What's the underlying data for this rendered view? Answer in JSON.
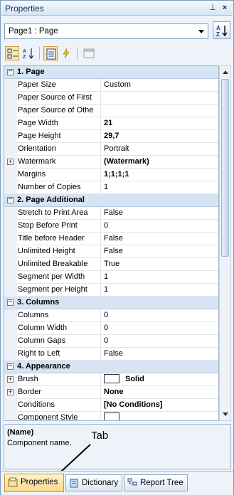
{
  "window": {
    "title": "Properties",
    "pin_glyph": "⊥",
    "close_glyph": "×"
  },
  "selector": {
    "value": "Page1 : Page"
  },
  "toolbar": {
    "buttons": [
      {
        "name": "categorized-icon",
        "active": true
      },
      {
        "name": "alphabetical-icon",
        "active": false
      },
      {
        "name": "properties-view-icon",
        "active": true
      },
      {
        "name": "events-lightning-icon",
        "active": false
      },
      {
        "name": "property-pages-icon",
        "active": false
      }
    ]
  },
  "grid": {
    "sections": [
      {
        "title": "1. Page",
        "expander": "−",
        "rows": [
          {
            "name": "Paper Size",
            "value": "Custom"
          },
          {
            "name": "Paper Source of First",
            "value": ""
          },
          {
            "name": "Paper Source of Othe",
            "value": ""
          },
          {
            "name": "Page Width",
            "value": "21",
            "bold": true
          },
          {
            "name": "Page Height",
            "value": "29,7",
            "bold": true
          },
          {
            "name": "Orientation",
            "value": "Portrait"
          },
          {
            "name": "Watermark",
            "value": "(Watermark)",
            "bold": true,
            "expander": "+"
          },
          {
            "name": "Margins",
            "value": "1;1;1;1",
            "bold": true
          },
          {
            "name": "Number of Copies",
            "value": "1"
          }
        ]
      },
      {
        "title": "2. Page  Additional",
        "expander": "−",
        "rows": [
          {
            "name": "Stretch to Print Area",
            "value": "False"
          },
          {
            "name": "Stop Before Print",
            "value": "0"
          },
          {
            "name": "Title before Header",
            "value": "False"
          },
          {
            "name": "Unlimited Height",
            "value": "False"
          },
          {
            "name": "Unlimited Breakable",
            "value": "True"
          },
          {
            "name": "Segment per Width",
            "value": "1"
          },
          {
            "name": "Segment per Height",
            "value": "1"
          }
        ]
      },
      {
        "title": "3. Columns",
        "expander": "−",
        "rows": [
          {
            "name": "Columns",
            "value": "0"
          },
          {
            "name": "Column Width",
            "value": "0"
          },
          {
            "name": "Column Gaps",
            "value": "0"
          },
          {
            "name": "Right to Left",
            "value": "False"
          }
        ]
      },
      {
        "title": "4. Appearance",
        "expander": "−",
        "rows": [
          {
            "name": "Brush",
            "value": "Solid",
            "bold": true,
            "expander": "+",
            "swatch": true
          },
          {
            "name": "Border",
            "value": "None",
            "bold": true,
            "expander": "+"
          },
          {
            "name": "Conditions",
            "value": "[No Conditions]",
            "bold": true
          },
          {
            "name": "Component Style",
            "value": "",
            "swatch": true
          }
        ]
      }
    ]
  },
  "description": {
    "name": "(Name)",
    "text": "Component name."
  },
  "annotation": {
    "text": "Tab"
  },
  "tabs": [
    {
      "label": "Properties",
      "icon": "properties-tab-icon",
      "selected": true
    },
    {
      "label": "Dictionary",
      "icon": "dictionary-tab-icon",
      "selected": false
    },
    {
      "label": "Report Tree",
      "icon": "report-tree-tab-icon",
      "selected": false
    }
  ]
}
